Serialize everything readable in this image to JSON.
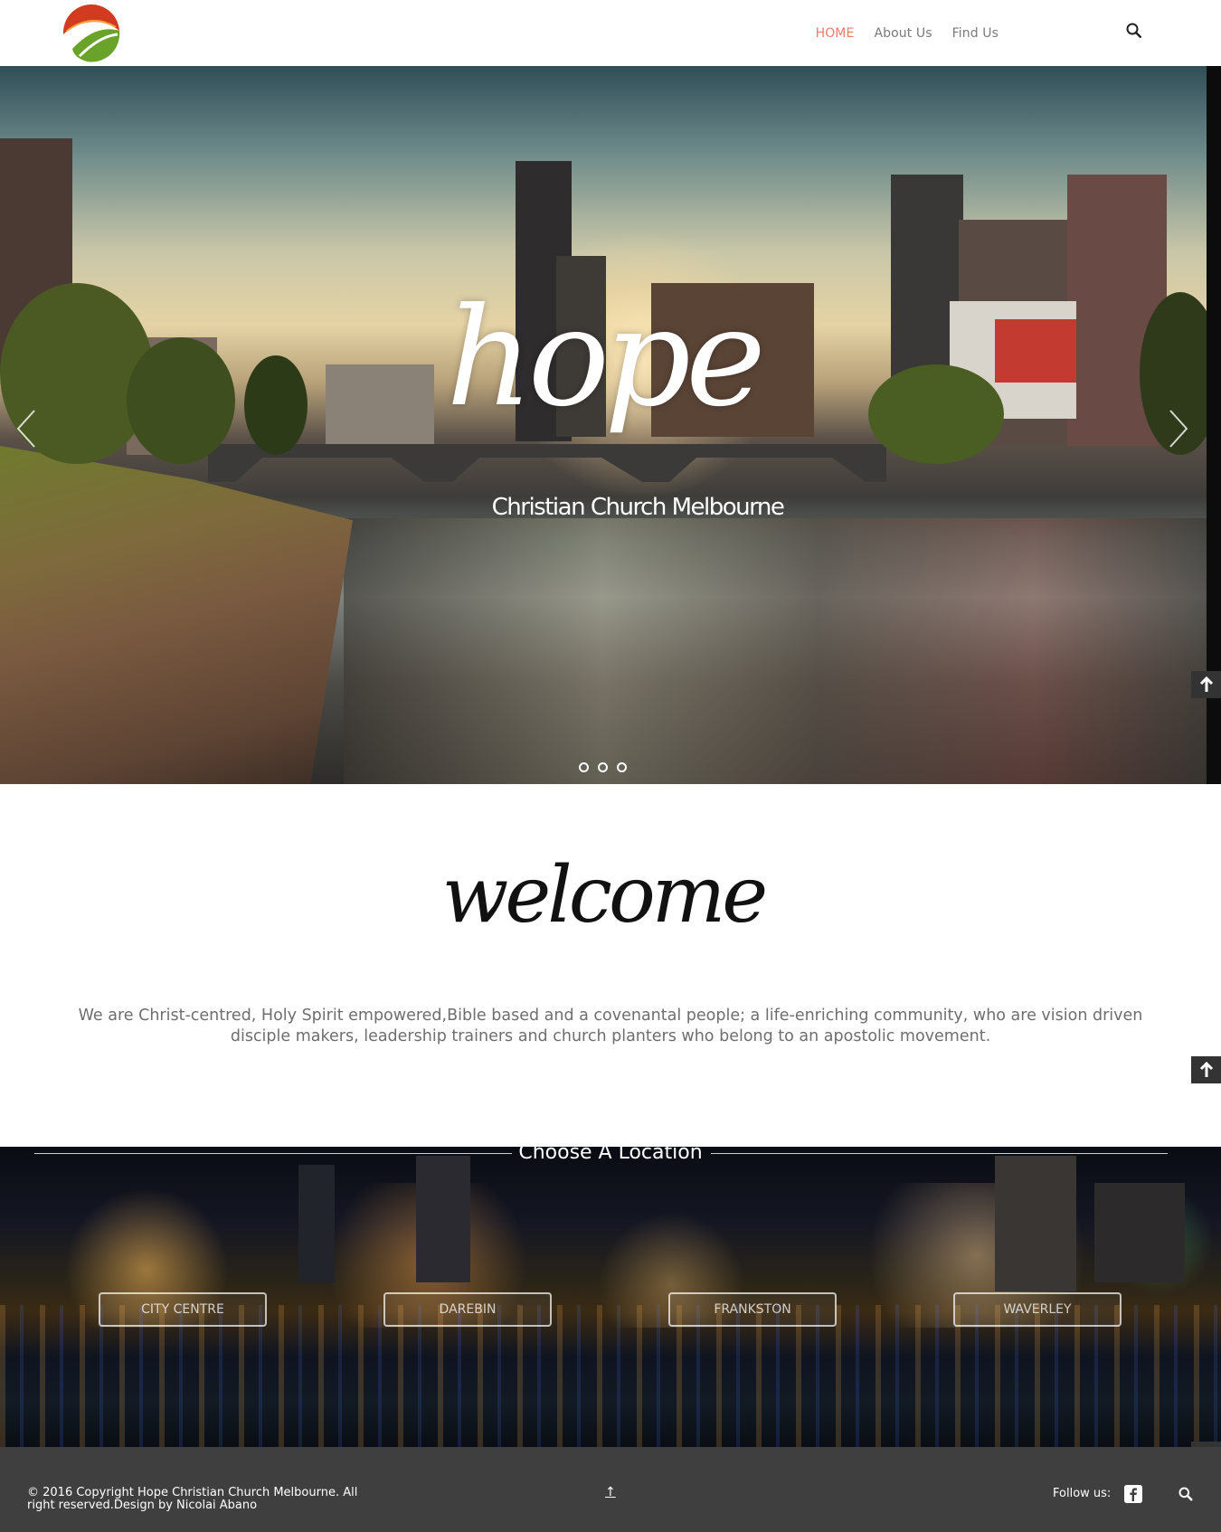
{
  "nav": {
    "items": [
      {
        "label": "HOME",
        "active": true
      },
      {
        "label": "About Us",
        "active": false
      },
      {
        "label": "Find Us",
        "active": false
      }
    ],
    "active_color": "#f07a6a"
  },
  "hero": {
    "title": "hope",
    "subtitle": "Christian Church Melbourne",
    "slide_count": 3
  },
  "welcome": {
    "title": "welcome",
    "text": "We are Christ-centred, Holy Spirit empowered,Bible based and a covenantal people; a life-enriching community, who are vision driven disciple makers, leadership trainers and church planters who belong to an apostolic movement."
  },
  "locations": {
    "heading": "Choose A Location",
    "buttons": [
      "CITY CENTRE",
      "DAREBIN",
      "FRANKSTON",
      "WAVERLEY"
    ]
  },
  "footer": {
    "copyright": "© 2016 Copyright Hope Christian Church Melbourne. All right reserved.Design by Nicolai Abano",
    "up_glyph": "↑",
    "follow_label": "Follow us:"
  },
  "icons": {
    "logo": "church-logo",
    "search": "search-icon",
    "back_to_top": "arrow-up-icon",
    "social": "facebook-icon"
  }
}
